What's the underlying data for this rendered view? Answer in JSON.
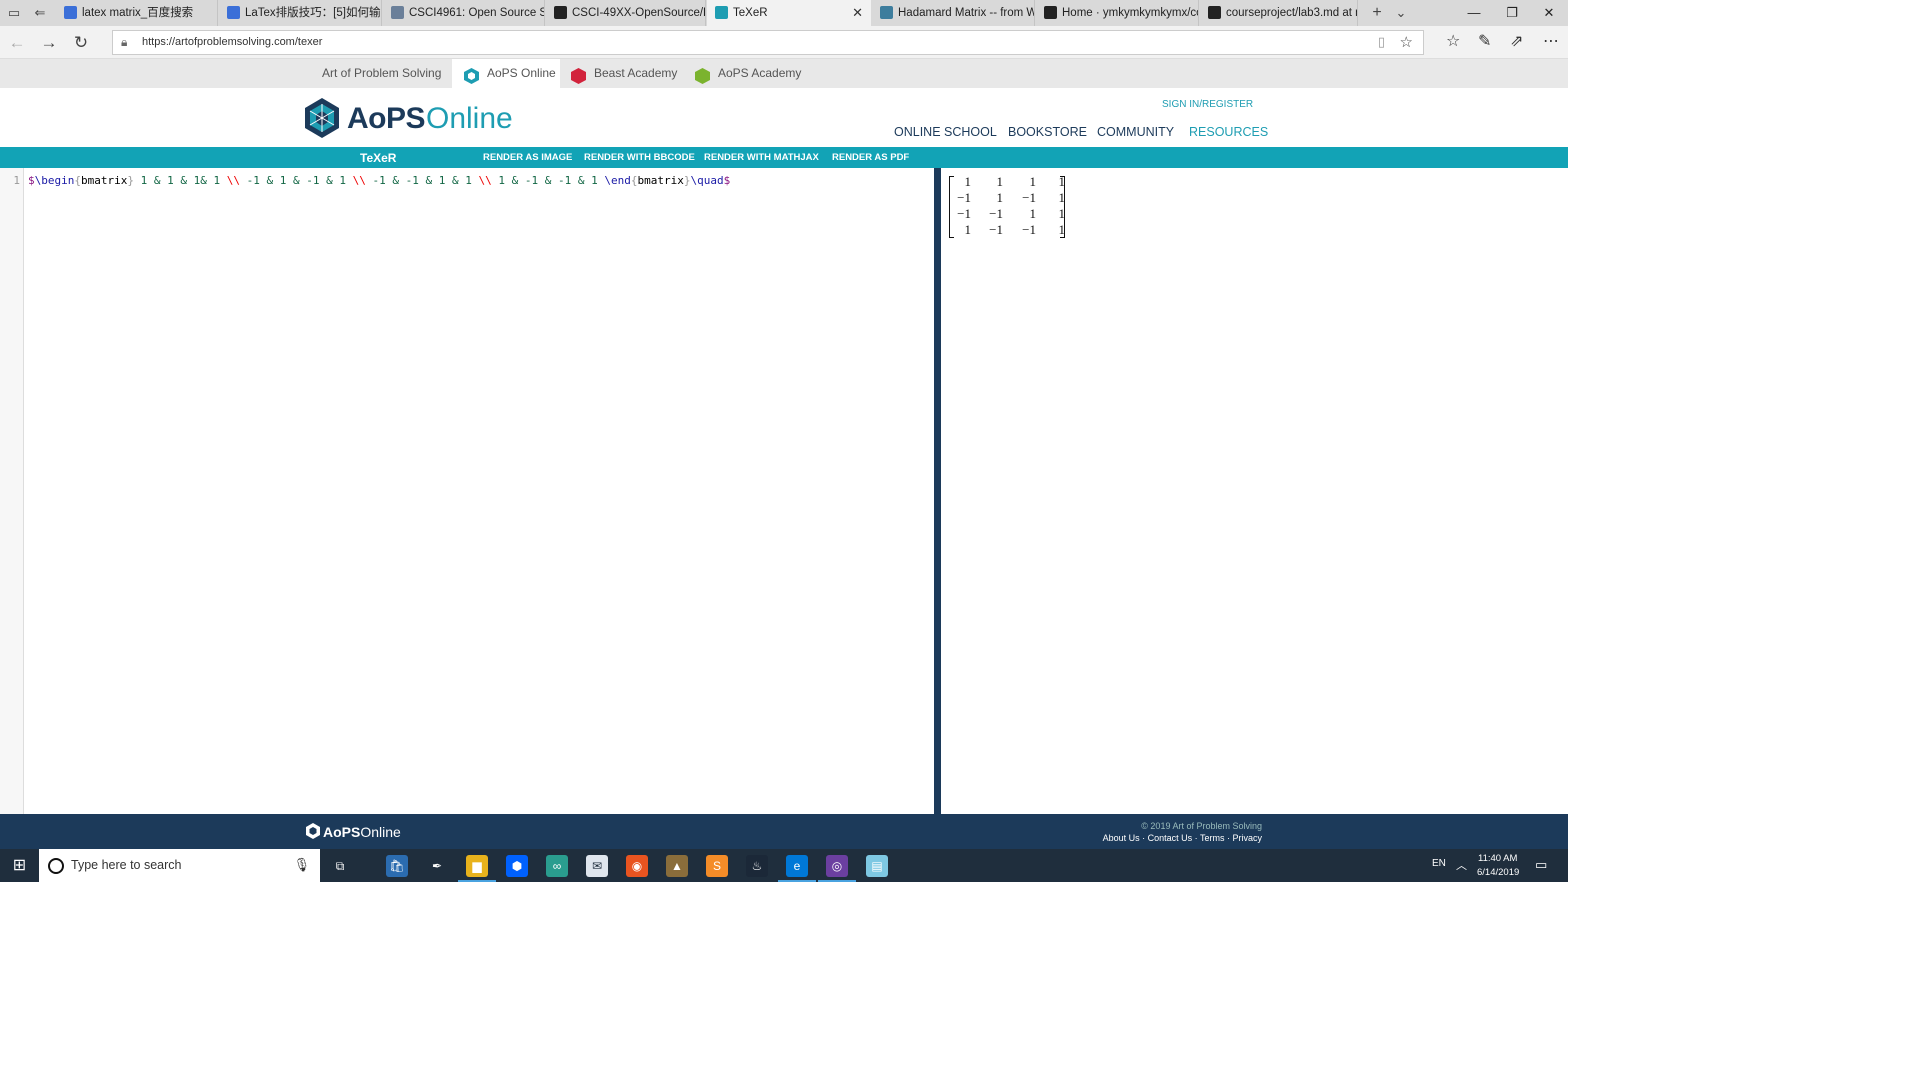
{
  "browser": {
    "tabs": [
      {
        "title": "latex matrix_百度搜索",
        "favicon_color": "#3b6fd8"
      },
      {
        "title": "LaTex排版技巧：[5]如何输入",
        "favicon_color": "#3b6fd8"
      },
      {
        "title": "CSCI4961: Open Source Sof",
        "favicon_color": "#6a7f99"
      },
      {
        "title": "CSCI-49XX-OpenSource/La",
        "favicon_color": "#222222"
      },
      {
        "title": "TeXeR",
        "favicon_color": "#1e9db2"
      },
      {
        "title": "Hadamard Matrix -- from W",
        "favicon_color": "#3d7d9d"
      },
      {
        "title": "Home · ymkymkymkymx/co",
        "favicon_color": "#222222"
      },
      {
        "title": "courseproject/lab3.md at m",
        "favicon_color": "#222222"
      }
    ],
    "active_tab_index": 4,
    "url": "https://artofproblemsolving.com/texer"
  },
  "site_nav": {
    "items": [
      "Art of Problem Solving",
      "AoPS Online",
      "Beast Academy",
      "AoPS Academy"
    ],
    "active": "AoPS Online"
  },
  "header": {
    "brand_bold": "AoPS",
    "brand_light": "Online",
    "signin": "SIGN IN/REGISTER",
    "nav": [
      "ONLINE SCHOOL",
      "BOOKSTORE",
      "COMMUNITY",
      "RESOURCES"
    ],
    "nav_current": "RESOURCES"
  },
  "texer": {
    "title": "TeXeR",
    "buttons": [
      "RENDER AS IMAGE",
      "RENDER WITH BBCODE",
      "RENDER WITH MATHJAX",
      "RENDER AS PDF"
    ]
  },
  "editor": {
    "line_number": "1",
    "code": "$\\begin{bmatrix} 1 & 1 & 1& 1 \\\\ -1 & 1 & -1 & 1 \\\\ -1 & -1 & 1 & 1 \\\\ 1 & -1 & -1 & 1 \\end{bmatrix}\\quad$"
  },
  "preview": {
    "matrix": [
      [
        "1",
        "1",
        "1",
        "1"
      ],
      [
        "−1",
        "1",
        "−1",
        "1"
      ],
      [
        "−1",
        "−1",
        "1",
        "1"
      ],
      [
        "1",
        "−1",
        "−1",
        "1"
      ]
    ]
  },
  "footer": {
    "brand_bold": "AoPS",
    "brand_light": "Online",
    "copyright": "© 2019 Art of Problem Solving",
    "links": [
      "About Us",
      "Contact Us",
      "Terms",
      "Privacy"
    ]
  },
  "taskbar": {
    "search_placeholder": "Type here to search",
    "apps": [
      "task-view",
      "store",
      "pen",
      "file-explorer",
      "dropbox",
      "arduino",
      "mail",
      "ubuntu",
      "league",
      "sublime",
      "steam",
      "edge",
      "pop",
      "notepad"
    ],
    "language": "EN",
    "time": "11:40 AM",
    "date": "6/14/2019"
  },
  "colors": {
    "teal": "#12a3b6",
    "navy": "#1c3a5a",
    "taskbar": "#1f2e3d"
  }
}
